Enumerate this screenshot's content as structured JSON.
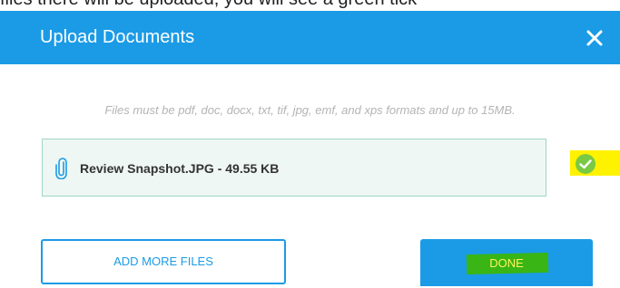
{
  "top_cut_text": "files there will be uploaded, you will see a green tick",
  "dialog": {
    "title": "Upload Documents",
    "close_icon": "close-icon"
  },
  "hint": "Files must be pdf, doc, docx, txt, tif, jpg, emf, and xps formats and up to 15MB.",
  "file": {
    "icon": "paperclip-icon",
    "name": "Review Snapshot.JPG - 49.55 KB",
    "status_icon": "green-check-icon"
  },
  "buttons": {
    "add_more": "ADD MORE FILES",
    "done": "DONE"
  },
  "colors": {
    "accent": "#1b9be6",
    "file_box_bg": "#eef7f3",
    "file_box_border": "#9fd6c5",
    "check": "#7ac943",
    "highlight_yellow": "#fff200",
    "highlight_green": "#39b516"
  }
}
